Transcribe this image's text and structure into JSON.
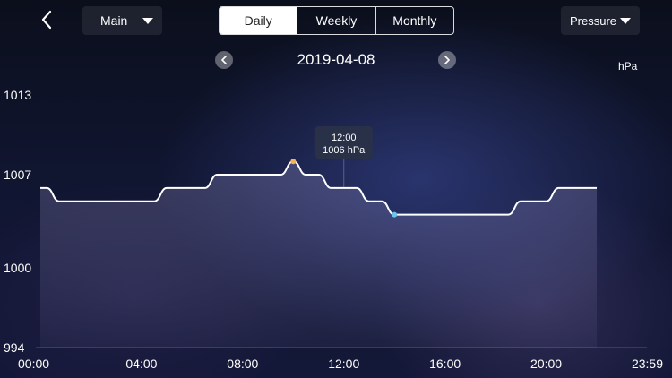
{
  "header": {
    "back_icon": "chevron-left-icon",
    "main_dropdown": {
      "label": "Main",
      "icon": "caret-down-icon"
    },
    "range_tabs": [
      {
        "label": "Daily",
        "active": true
      },
      {
        "label": "Weekly",
        "active": false
      },
      {
        "label": "Monthly",
        "active": false
      }
    ],
    "metric_dropdown": {
      "label": "Pressure",
      "icon": "caret-down-icon"
    }
  },
  "date_nav": {
    "date": "2019-04-08",
    "prev_icon": "chevron-left-icon",
    "next_icon": "chevron-right-icon"
  },
  "colors": {
    "line": "#ffffff",
    "max_marker": "#f5b25a",
    "min_marker": "#6fc3ee",
    "tooltip_bg": "#2a3148"
  },
  "chart_data": {
    "type": "area",
    "ylabel": "hPa",
    "ylim": [
      994,
      1013
    ],
    "y_ticks": [
      "1013",
      "1007",
      "1000",
      "994"
    ],
    "x_ticks": [
      "00:00",
      "04:00",
      "08:00",
      "12:00",
      "16:00",
      "20:00",
      "23:59"
    ],
    "grid": false,
    "series": [
      {
        "x": [
          "00:00",
          "00:15",
          "00:45",
          "01:00",
          "02:00",
          "03:00",
          "04:00",
          "04:30",
          "05:00",
          "06:00",
          "06:30",
          "07:00",
          "08:00",
          "09:00",
          "09:30",
          "10:00",
          "10:30",
          "11:00",
          "11:30",
          "12:00",
          "12:30",
          "13:00",
          "13:30",
          "14:00",
          "15:00",
          "16:00",
          "17:00",
          "18:00",
          "18:30",
          "19:00",
          "20:00",
          "20:30",
          "21:00",
          "22:00"
        ],
        "values": [
          1006,
          1006,
          1005,
          1005,
          1005,
          1005,
          1005,
          1005,
          1006,
          1006,
          1006,
          1007,
          1007,
          1007,
          1007,
          1008,
          1007,
          1007,
          1006,
          1006,
          1006,
          1005,
          1005,
          1004,
          1004,
          1004,
          1004,
          1004,
          1004,
          1005,
          1005,
          1006,
          1006,
          1006
        ]
      }
    ],
    "max_point": {
      "x": "10:00",
      "value": 1008
    },
    "min_point": {
      "x": "14:00",
      "value": 1004
    },
    "tooltip": {
      "time": "12:00",
      "value_text": "1006 hPa"
    }
  }
}
